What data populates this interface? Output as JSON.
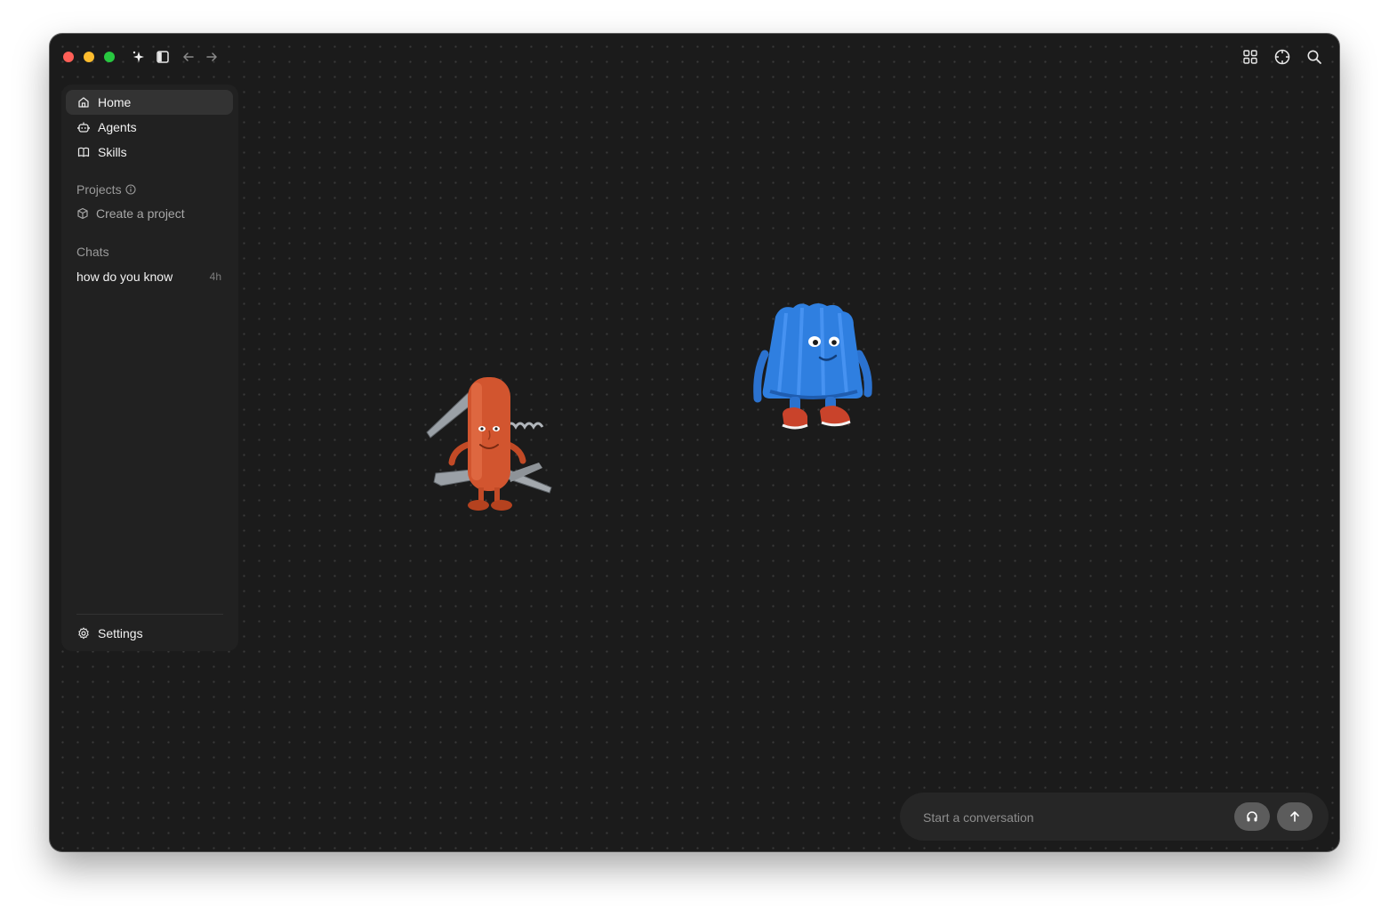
{
  "window": {
    "title_bar": {
      "traffic_lights": [
        "close",
        "minimize",
        "maximize"
      ],
      "left_icons": [
        "sparkle-icon",
        "sidebar-toggle-icon",
        "back-arrow-icon",
        "forward-arrow-icon"
      ],
      "right_icons": [
        "grid-icon",
        "crosshair-icon",
        "search-icon"
      ]
    }
  },
  "sidebar": {
    "nav": [
      {
        "label": "Home",
        "icon": "home-icon",
        "active": true
      },
      {
        "label": "Agents",
        "icon": "robot-icon",
        "active": false
      },
      {
        "label": "Skills",
        "icon": "book-icon",
        "active": false
      }
    ],
    "projects": {
      "label": "Projects",
      "create_label": "Create a project"
    },
    "chats": {
      "label": "Chats",
      "items": [
        {
          "title": "how do you know",
          "time": "4h"
        }
      ]
    },
    "settings_label": "Settings"
  },
  "canvas": {
    "mascots": [
      "pocket-knife-mascot",
      "blue-jelly-mascot"
    ]
  },
  "composer": {
    "placeholder": "Start a conversation"
  },
  "colors": {
    "background": "#1b1b1b",
    "sidebar": "#212121",
    "active_item": "#333333",
    "composer": "#262626",
    "button": "#5c5c5c",
    "knife_red": "#d2552f",
    "jelly_blue": "#2f7fe0"
  }
}
